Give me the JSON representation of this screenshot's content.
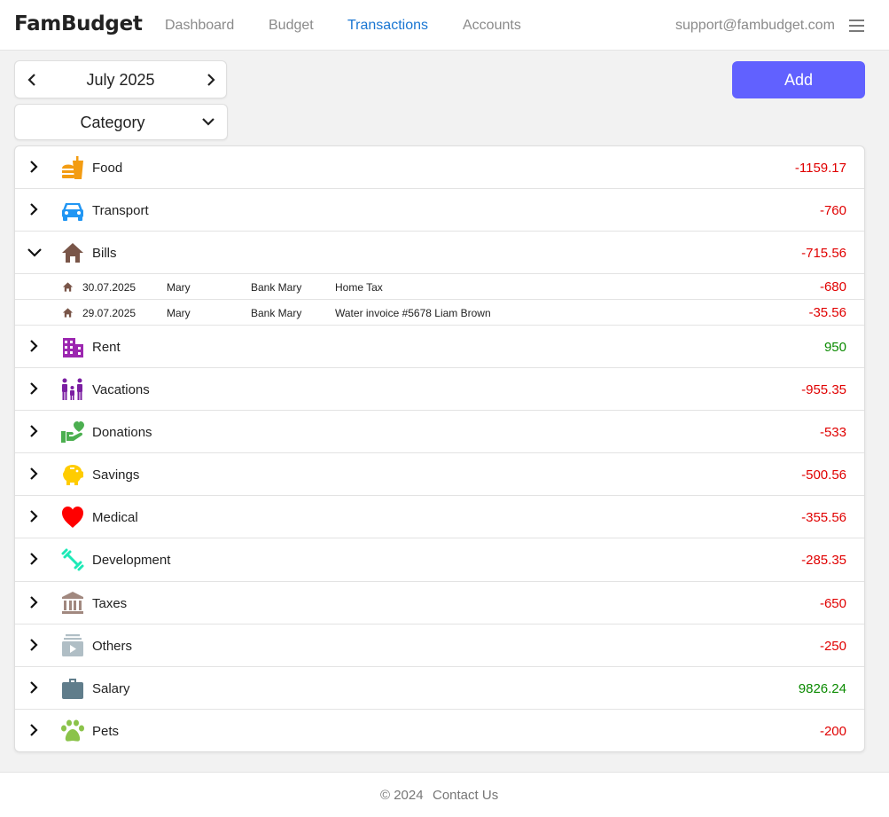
{
  "app": {
    "brand": "FamBudget"
  },
  "nav": {
    "items": [
      {
        "label": "Dashboard"
      },
      {
        "label": "Budget"
      },
      {
        "label": "Transactions",
        "active": true
      },
      {
        "label": "Accounts"
      }
    ],
    "support_email": "support@fambudget.com"
  },
  "controls": {
    "month": "July 2025",
    "group_by": "Category",
    "add_label": "Add"
  },
  "categories": [
    {
      "name": "Food",
      "icon": "fastfood-icon",
      "color": "#f39c12",
      "amount": "-1159.17",
      "expanded": false
    },
    {
      "name": "Transport",
      "icon": "car-icon",
      "color": "#2196f3",
      "amount": "-760",
      "expanded": false
    },
    {
      "name": "Bills",
      "icon": "home-icon",
      "color": "#795548",
      "amount": "-715.56",
      "expanded": true,
      "transactions": [
        {
          "date": "30.07.2025",
          "member": "Mary",
          "account": "Bank Mary",
          "description": "Home Tax",
          "amount": "-680"
        },
        {
          "date": "29.07.2025",
          "member": "Mary",
          "account": "Bank Mary",
          "description": "Water invoice #5678 Liam Brown",
          "amount": "-35.56"
        }
      ]
    },
    {
      "name": "Rent",
      "icon": "building-icon",
      "color": "#9c27b0",
      "amount": "950",
      "expanded": false
    },
    {
      "name": "Vacations",
      "icon": "family-icon",
      "color": "#7b1fa2",
      "amount": "-955.35",
      "expanded": false
    },
    {
      "name": "Donations",
      "icon": "heart-hand-icon",
      "color": "#4caf50",
      "amount": "-533",
      "expanded": false
    },
    {
      "name": "Savings",
      "icon": "piggy-bank-icon",
      "color": "#ffcc00",
      "amount": "-500.56",
      "expanded": false
    },
    {
      "name": "Medical",
      "icon": "heart-icon",
      "color": "#ff0000",
      "amount": "-355.56",
      "expanded": false
    },
    {
      "name": "Development",
      "icon": "dumbbell-icon",
      "color": "#1de9b6",
      "amount": "-285.35",
      "expanded": false
    },
    {
      "name": "Taxes",
      "icon": "bank-icon",
      "color": "#a1887f",
      "amount": "-650",
      "expanded": false
    },
    {
      "name": "Others",
      "icon": "media-stack-icon",
      "color": "#b0bec5",
      "amount": "-250",
      "expanded": false
    },
    {
      "name": "Salary",
      "icon": "briefcase-icon",
      "color": "#607d8b",
      "amount": "9826.24",
      "expanded": false
    },
    {
      "name": "Pets",
      "icon": "paw-icon",
      "color": "#8bc34a",
      "amount": "-200",
      "expanded": false
    }
  ],
  "footer": {
    "copyright": "© 2024",
    "contact": "Contact Us"
  }
}
